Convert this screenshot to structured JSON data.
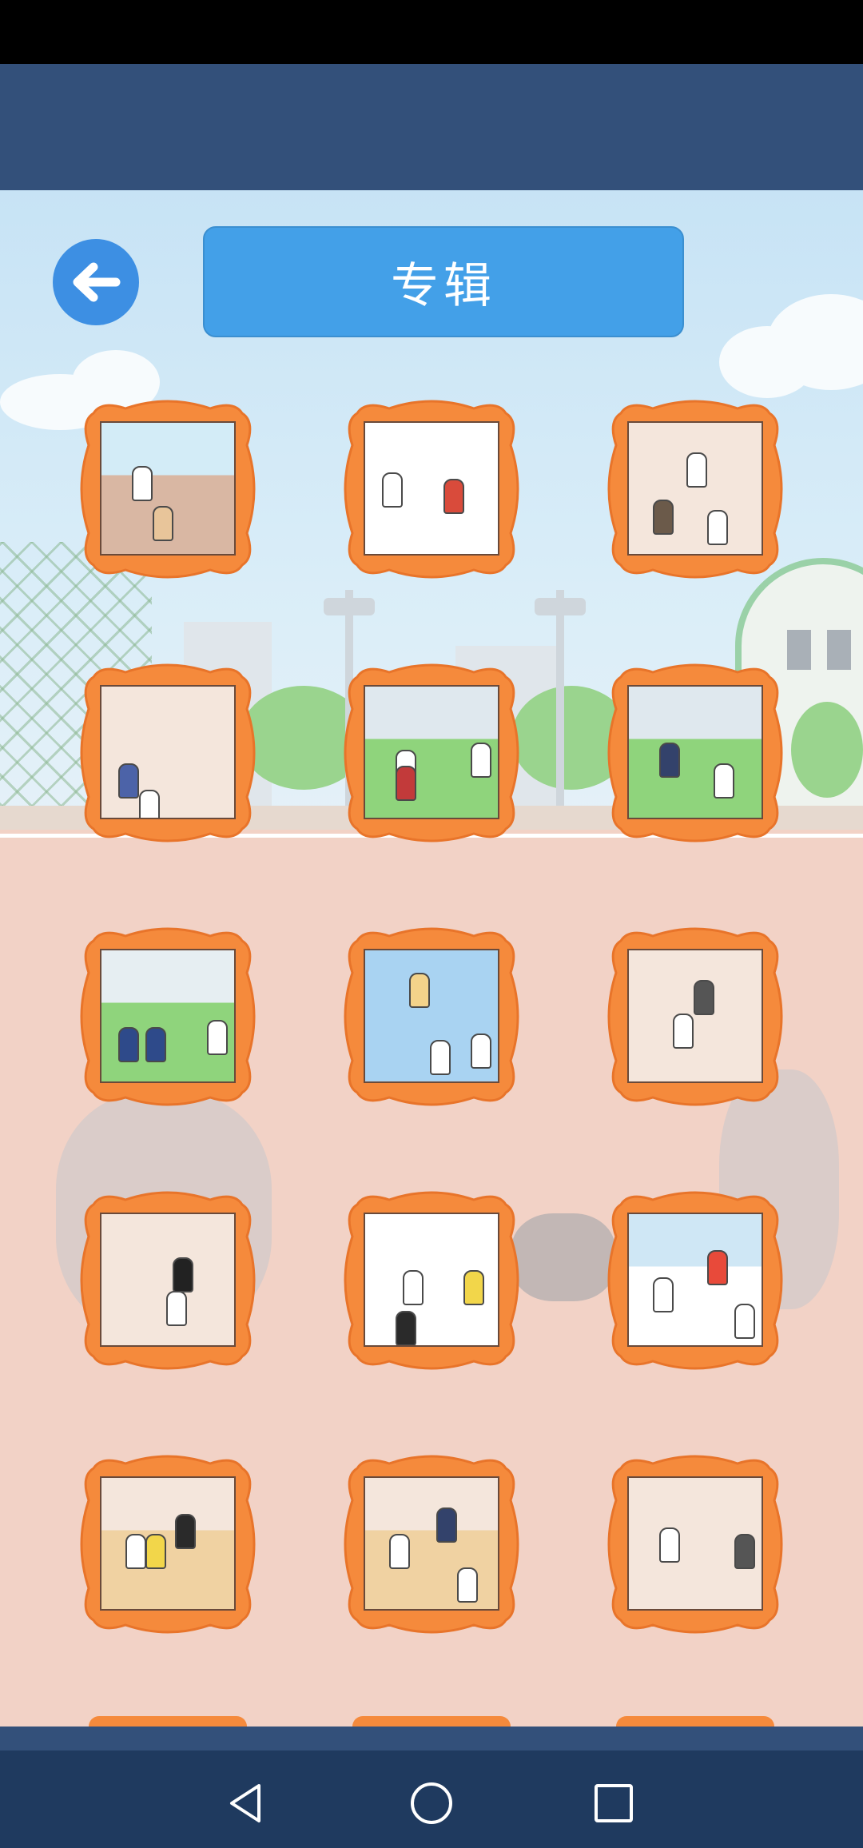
{
  "header": {
    "title": "专辑",
    "back_icon": "arrow-left-icon"
  },
  "album": {
    "frame_color": "#f58a3c",
    "items": [
      {
        "scene": "track-fall",
        "bg": "#d9b7a3",
        "top": "#d3ecf7",
        "figs": [
          [
            "#ffffff",
            0.3,
            0.45
          ],
          [
            "#e8c59a",
            0.45,
            0.75
          ]
        ]
      },
      {
        "scene": "strongman",
        "bg": "#ffffff",
        "top": "#ffffff",
        "figs": [
          [
            "#ffffff",
            0.2,
            0.5
          ],
          [
            "#d94b3b",
            0.65,
            0.55
          ]
        ]
      },
      {
        "scene": "classroom-table",
        "bg": "#f4e6dc",
        "top": "#f4e6dc",
        "figs": [
          [
            "#ffffff",
            0.5,
            0.35
          ],
          [
            "#6b5a4a",
            0.25,
            0.7
          ],
          [
            "#ffffff",
            0.65,
            0.78
          ]
        ]
      },
      {
        "scene": "hallway-door",
        "bg": "#f4e6dc",
        "top": "#f4e6dc",
        "figs": [
          [
            "#4c63a8",
            0.2,
            0.7
          ],
          [
            "#ffffff",
            0.35,
            0.9
          ]
        ]
      },
      {
        "scene": "garden-chase",
        "bg": "#8fd47c",
        "top": "#dfe8ee",
        "figs": [
          [
            "#ffffff",
            0.3,
            0.6
          ],
          [
            "#c23a3a",
            0.3,
            0.72
          ],
          [
            "#ffffff",
            0.85,
            0.55
          ]
        ]
      },
      {
        "scene": "garden-bush",
        "bg": "#8fd47c",
        "top": "#dfe8ee",
        "figs": [
          [
            "#33426b",
            0.3,
            0.55
          ],
          [
            "#ffffff",
            0.7,
            0.7
          ]
        ]
      },
      {
        "scene": "park-fight",
        "bg": "#8fd47c",
        "top": "#e6eef2",
        "figs": [
          [
            "#2e4a8a",
            0.2,
            0.7
          ],
          [
            "#2e4a8a",
            0.4,
            0.7
          ],
          [
            "#ffffff",
            0.85,
            0.65
          ]
        ]
      },
      {
        "scene": "lab-skeleton",
        "bg": "#a9d3f2",
        "top": "#a9d3f2",
        "figs": [
          [
            "#f4d38a",
            0.4,
            0.3
          ],
          [
            "#ffffff",
            0.55,
            0.8
          ],
          [
            "#ffffff",
            0.85,
            0.75
          ]
        ]
      },
      {
        "scene": "drum-room",
        "bg": "#f4e6dc",
        "top": "#f4e6dc",
        "figs": [
          [
            "#555555",
            0.55,
            0.35
          ],
          [
            "#ffffff",
            0.4,
            0.6
          ]
        ]
      },
      {
        "scene": "piano-room",
        "bg": "#f4e6dc",
        "top": "#f4e6dc",
        "figs": [
          [
            "#222222",
            0.6,
            0.45
          ],
          [
            "#ffffff",
            0.55,
            0.7
          ]
        ]
      },
      {
        "scene": "couple",
        "bg": "#ffffff",
        "top": "#ffffff",
        "figs": [
          [
            "#ffffff",
            0.35,
            0.55
          ],
          [
            "#f2d64a",
            0.8,
            0.55
          ],
          [
            "#2a2a2a",
            0.3,
            0.85
          ]
        ]
      },
      {
        "scene": "stretcher",
        "bg": "#ffffff",
        "top": "#cfe7f5",
        "figs": [
          [
            "#ffffff",
            0.25,
            0.6
          ],
          [
            "#e84a3a",
            0.65,
            0.4
          ],
          [
            "#ffffff",
            0.85,
            0.8
          ]
        ]
      },
      {
        "scene": "cafeteria-pole",
        "bg": "#f0d2a2",
        "top": "#f4e6dc",
        "figs": [
          [
            "#2a2a2a",
            0.62,
            0.4
          ],
          [
            "#ffffff",
            0.25,
            0.55
          ],
          [
            "#f2d64a",
            0.4,
            0.55
          ]
        ]
      },
      {
        "scene": "cafeteria-run",
        "bg": "#f0d2a2",
        "top": "#f4e6dc",
        "figs": [
          [
            "#33426b",
            0.6,
            0.35
          ],
          [
            "#ffffff",
            0.75,
            0.8
          ],
          [
            "#ffffff",
            0.25,
            0.55
          ]
        ]
      },
      {
        "scene": "doorway",
        "bg": "#f4e6dc",
        "top": "#f4e6dc",
        "figs": [
          [
            "#ffffff",
            0.3,
            0.5
          ],
          [
            "#555555",
            0.85,
            0.55
          ]
        ]
      }
    ]
  },
  "navbar": {
    "back_icon": "triangle-back-icon",
    "home_icon": "circle-home-icon",
    "recents_icon": "square-recents-icon"
  }
}
